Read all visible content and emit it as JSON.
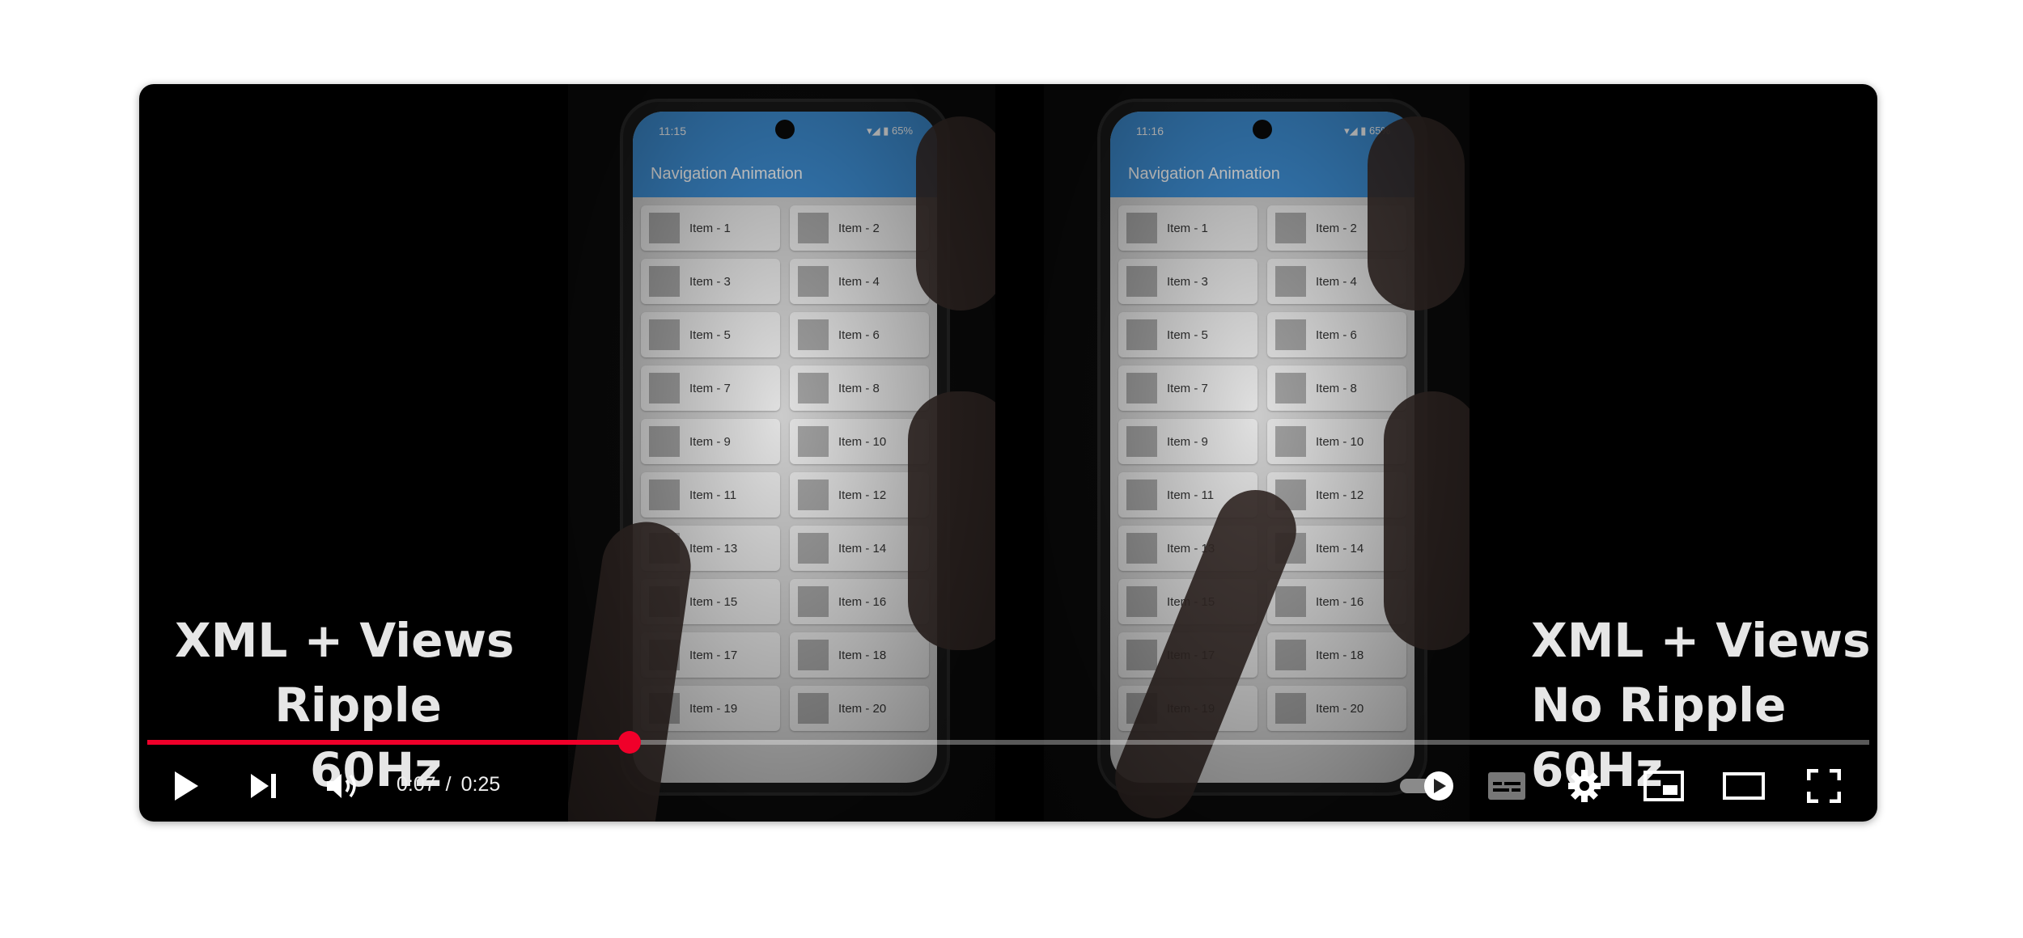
{
  "phone_app": {
    "title": "Navigation Animation",
    "status_time_left": "11:15",
    "status_time_right": "11:16",
    "status_icons": "▾◢ ▮ 65%",
    "items": [
      "Item - 1",
      "Item - 2",
      "Item - 3",
      "Item - 4",
      "Item - 5",
      "Item - 6",
      "Item - 7",
      "Item - 8",
      "Item - 9",
      "Item - 10",
      "Item - 11",
      "Item - 12",
      "Item - 13",
      "Item - 14",
      "Item - 15",
      "Item - 16",
      "Item - 17",
      "Item - 18",
      "Item - 19",
      "Item - 20"
    ]
  },
  "captions": {
    "left": {
      "line1": "XML + Views",
      "line2": "Ripple",
      "line3": "60Hz"
    },
    "right": {
      "line1": "XML + Views",
      "line2": "No Ripple",
      "line3": "60Hz"
    }
  },
  "player": {
    "current_time": "0:07",
    "separator": "/",
    "duration": "0:25",
    "progress_fraction": 0.28,
    "accent_color": "#f0002a",
    "icons": {
      "play": "play-icon",
      "next": "next-icon",
      "volume": "volume-icon",
      "autoplay": "autoplay-toggle-icon",
      "subtitles": "subtitles-icon",
      "settings": "gear-icon",
      "miniplayer": "miniplayer-icon",
      "theater": "theater-mode-icon",
      "fullscreen": "fullscreen-icon"
    }
  }
}
